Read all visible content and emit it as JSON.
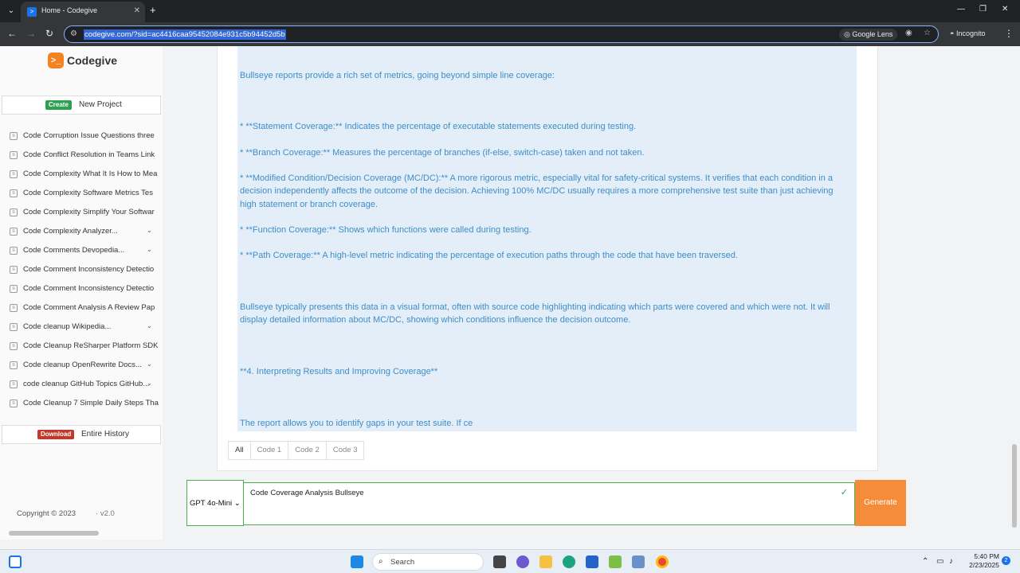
{
  "browser": {
    "tab_title": "Home - Codegive",
    "url": "codegive.com/?sid=ac4416caa95452084e931c5b94452d5b",
    "google_lens_label": "Google Lens",
    "incognito_label": "Incognito"
  },
  "sidebar": {
    "logo_text": "Codegive",
    "new_project": {
      "badge": "Create",
      "label": "New Project"
    },
    "history": [
      {
        "label": "Code Corruption Issue Questions three",
        "chevron": false
      },
      {
        "label": "Code Conflict Resolution in Teams Link",
        "chevron": false
      },
      {
        "label": "Code Complexity What It Is How to Mea",
        "chevron": false
      },
      {
        "label": "Code Complexity Software Metrics Tes",
        "chevron": false
      },
      {
        "label": "Code Complexity Simplify Your Softwar",
        "chevron": false
      },
      {
        "label": "Code Complexity Analyzer...",
        "chevron": true
      },
      {
        "label": "Code Comments Devopedia...",
        "chevron": true
      },
      {
        "label": "Code Comment Inconsistency Detectio",
        "chevron": false
      },
      {
        "label": "Code Comment Inconsistency Detectio",
        "chevron": false
      },
      {
        "label": "Code Comment Analysis A Review Pap",
        "chevron": false
      },
      {
        "label": "Code cleanup Wikipedia...",
        "chevron": true
      },
      {
        "label": "Code Cleanup ReSharper Platform SDK",
        "chevron": false
      },
      {
        "label": "Code cleanup OpenRewrite Docs...",
        "chevron": true
      },
      {
        "label": "code cleanup GitHub Topics GitHub...",
        "chevron": true
      },
      {
        "label": "Code Cleanup 7 Simple Daily Steps Tha",
        "chevron": false
      }
    ],
    "download": {
      "badge": "Download",
      "label": "Entire History"
    },
    "copyright": "Copyright © 2023",
    "version": "v2.0"
  },
  "content": {
    "paragraphs": [
      "Bullseye reports provide a rich set of metrics, going beyond simple line coverage:",
      "* **Statement Coverage:**  Indicates the percentage of executable statements executed during testing.",
      "* **Branch Coverage:** Measures the percentage of branches (if-else, switch-case) taken and not taken.",
      "* **Modified Condition/Decision Coverage (MC/DC):**  A more rigorous metric, especially vital for safety-critical systems.  It verifies that each condition in a decision independently affects the outcome of the decision.  Achieving 100% MC/DC usually requires a more comprehensive test suite than just achieving high statement or branch coverage.",
      "* **Function Coverage:** Shows which functions were called during testing.",
      "* **Path Coverage:**  A high-level metric indicating the percentage of execution paths through the code that have been traversed.",
      "Bullseye typically presents this data in a visual format, often with source code highlighting indicating which parts were covered and which were not.  It will display detailed information about MC/DC, showing which conditions influence the decision outcome.",
      "**4. Interpreting Results and Improving Coverage**",
      "The report allows you to identify gaps in your test suite.  If ce"
    ],
    "tabs": [
      "All",
      "Code 1",
      "Code 2",
      "Code 3"
    ],
    "active_tab": "All"
  },
  "input": {
    "model": "GPT 4o-Mini",
    "prompt": "Code Coverage Analysis Bullseye",
    "generate_label": "Generate"
  },
  "taskbar": {
    "search_placeholder": "Search",
    "time": "5:40 PM",
    "date": "2/23/2025",
    "notification_count": "2"
  },
  "colors": {
    "brand": "#f58220",
    "generate": "#f58c3a",
    "content_text": "#3d8ec9",
    "content_bg": "#e4eef8",
    "accent_green": "#4caf50"
  }
}
